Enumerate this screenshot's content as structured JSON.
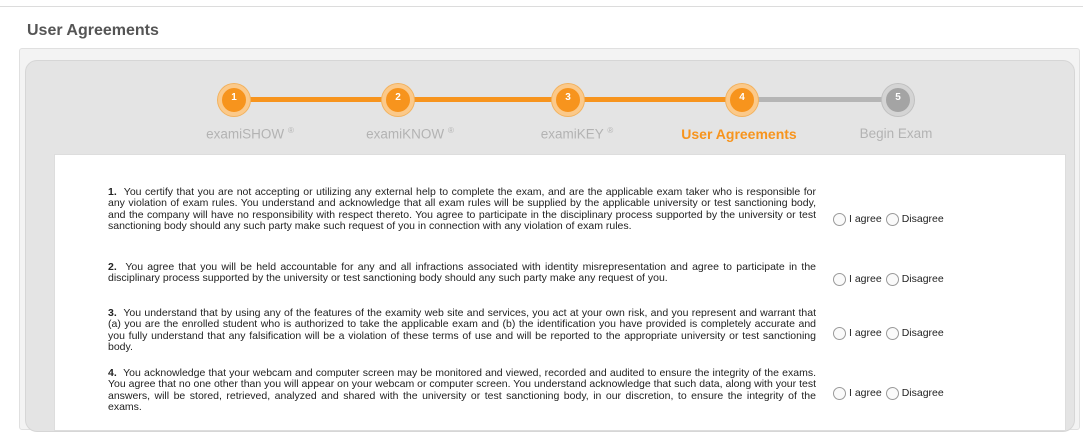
{
  "page": {
    "title": "User Agreements"
  },
  "stepper": {
    "steps": [
      {
        "number": "1",
        "label": "examiSHOW",
        "mark": "®",
        "state": "completed"
      },
      {
        "number": "2",
        "label": "examiKNOW",
        "mark": "®",
        "state": "completed"
      },
      {
        "number": "3",
        "label": "examiKEY",
        "mark": "®",
        "state": "completed"
      },
      {
        "number": "4",
        "label": "User Agreements",
        "mark": "",
        "state": "current"
      },
      {
        "number": "5",
        "label": "Begin Exam",
        "mark": "",
        "state": "upcoming"
      }
    ],
    "colors": {
      "active": "#f7941d",
      "inactive": "#a4a4a4"
    }
  },
  "agreements": [
    {
      "number": "1.",
      "text": "You certify that you are not accepting or utilizing any external help to complete the exam, and are the applicable exam taker who is responsible for any violation of exam rules. You understand and acknowledge that all exam rules will be supplied by the applicable university or test sanctioning body, and the company will have no responsibility with respect thereto. You agree to participate in the disciplinary process supported by the university or test sanctioning body should any such party make such request of you in connection with any violation of exam rules.",
      "agree_label": "I agree",
      "disagree_label": "Disagree"
    },
    {
      "number": "2.",
      "text": "You agree that you will be held accountable for any and all infractions associated with identity misrepresentation and agree to participate in the disciplinary process supported by the university or test sanctioning body should any such party make any request of you.",
      "agree_label": "I agree",
      "disagree_label": "Disagree"
    },
    {
      "number": "3.",
      "text": "You understand that by using any of the features of the examity web site and services, you act at your own risk, and you represent and warrant that (a) you are the enrolled student who is authorized to take the applicable exam and (b) the identification you have provided is completely accurate and you fully understand that any falsification will be a violation of these terms of use and will be reported to the appropriate university or test sanctioning body.",
      "agree_label": "I agree",
      "disagree_label": "Disagree"
    },
    {
      "number": "4.",
      "text": "You acknowledge that your webcam and computer screen may be monitored and viewed, recorded and audited to ensure the integrity of the exams. You agree that no one other than you will appear on your webcam or computer screen. You understand acknowledge that such data, along with your test answers, will be stored, retrieved, analyzed and shared with the university or test sanctioning body, in our discretion, to ensure the integrity of the exams.",
      "agree_label": "I agree",
      "disagree_label": "Disagree"
    }
  ]
}
